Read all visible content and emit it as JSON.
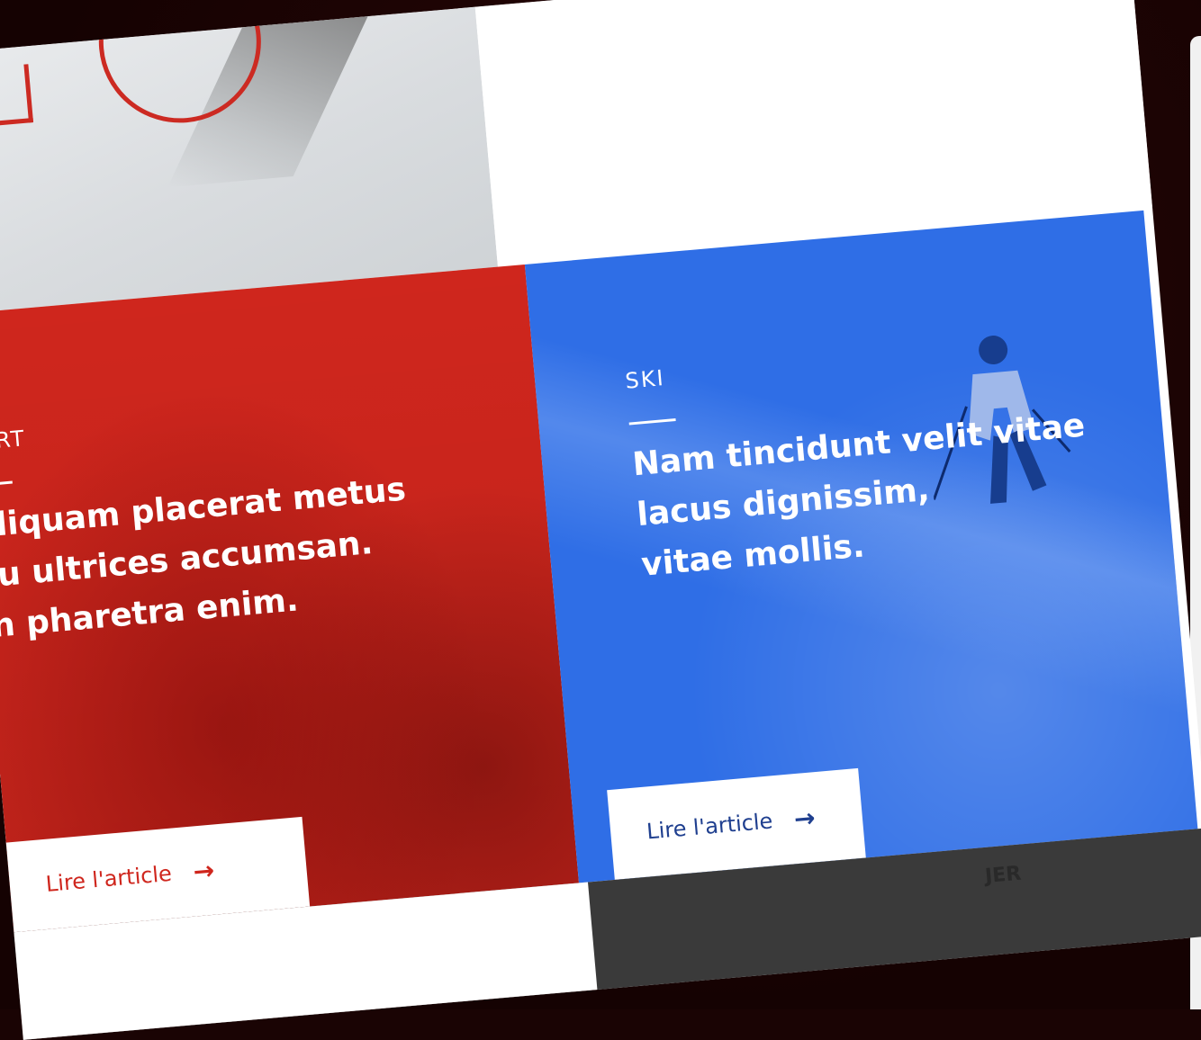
{
  "top_section": {
    "photo_alt": ""
  },
  "cards": [
    {
      "category": "PORT",
      "headline_lines": [
        "Aliquam placerat metus",
        "eu ultrices accumsan.",
        "In pharetra enim."
      ],
      "cta_label": "Lire l'article",
      "accent": "#cf261d"
    },
    {
      "category": "SKI",
      "headline_lines": [
        "Nam tincidunt velit vitae",
        "lacus dignissim,",
        "vitae mollis."
      ],
      "cta_label": "Lire l'article",
      "accent": "#2f6ee6"
    }
  ],
  "bottom": {
    "logo_text": "JER\nSORT"
  },
  "icons": {
    "arrow": "arrow-right-icon"
  },
  "colors": {
    "red": "#cf261d",
    "blue": "#2f6ee6",
    "bezel": "#1a0404"
  }
}
